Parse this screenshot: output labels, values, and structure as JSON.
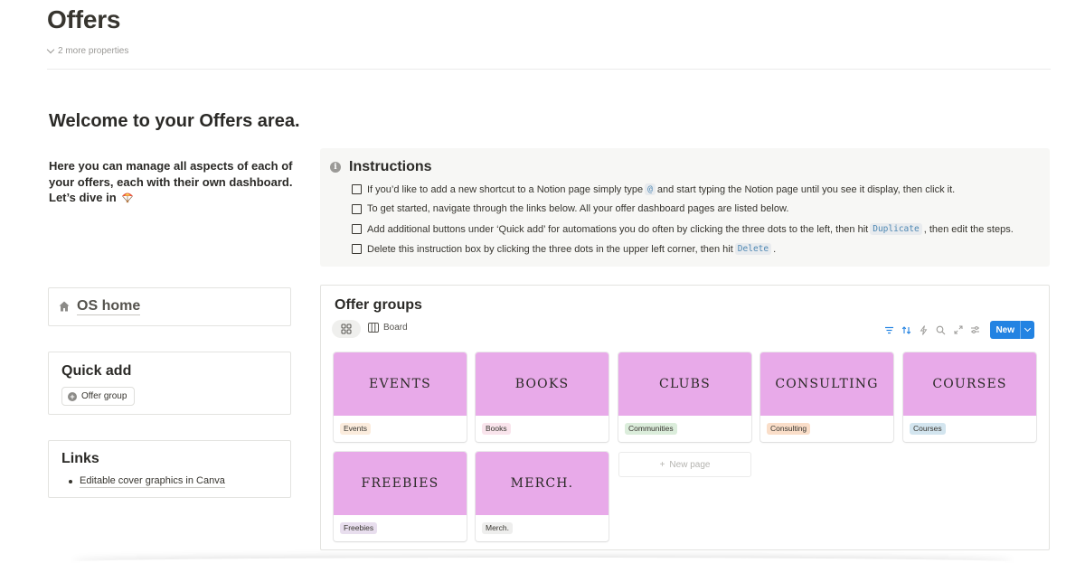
{
  "page": {
    "title": "Offers",
    "more_properties": "2 more properties"
  },
  "welcome": {
    "heading": "Welcome to your Offers area.",
    "intro": "Here you can manage all aspects of each of your offers, each with their own dashboard. Let’s dive in"
  },
  "instructions": {
    "title": "Instructions",
    "items": [
      {
        "before": "If you’d like to add a new shortcut to a Notion page simply type ",
        "code": "@",
        "after": " and start typing the Notion page until you see it display, then click it."
      },
      {
        "before": "To get started, navigate through the links below. All your offer dashboard pages are listed below.",
        "code": "",
        "after": ""
      },
      {
        "before": "Add additional buttons under ‘Quick add’ for automations you do often by clicking the three dots to the left, then hit ",
        "code": "Duplicate",
        "after": ", then edit the steps."
      },
      {
        "before": "Delete this instruction box by clicking the three dots in the upper left corner, then hit ",
        "code": "Delete",
        "after": "."
      }
    ]
  },
  "os_home": {
    "label": "OS home"
  },
  "quick_add": {
    "title": "Quick add",
    "button": "Offer group"
  },
  "links": {
    "title": "Links",
    "items": [
      "Editable cover graphics in Canva"
    ]
  },
  "offer_groups": {
    "title": "Offer groups",
    "view_label": "Board",
    "new_button": "New",
    "new_page": "New page",
    "cards": [
      {
        "cover": "EVENTS",
        "tag": "Events",
        "tag_bg": "#fbecdd"
      },
      {
        "cover": "BOOKS",
        "tag": "Books",
        "tag_bg": "#f9e4ec"
      },
      {
        "cover": "CLUBS",
        "tag": "Communities",
        "tag_bg": "#dbeddb"
      },
      {
        "cover": "CONSULTING",
        "tag": "Consulting",
        "tag_bg": "#fadec9"
      },
      {
        "cover": "COURSES",
        "tag": "Courses",
        "tag_bg": "#d3e5ef"
      },
      {
        "cover": "FREEBIES",
        "tag": "Freebies",
        "tag_bg": "#e8deee"
      },
      {
        "cover": "MERCH.",
        "tag": "Merch.",
        "tag_bg": "#eeeeed"
      }
    ]
  },
  "colors": {
    "accent": "#2383e2",
    "cover": "#e8aae9",
    "callout_bg": "#f7f7f5",
    "text": "#37352f"
  },
  "icons": [
    "chevron-down-icon",
    "info-icon",
    "parachute-icon",
    "home-icon",
    "plus-circle-icon",
    "gallery-view-icon",
    "board-view-icon",
    "filter-icon",
    "sort-icon",
    "lightning-icon",
    "search-icon",
    "expand-icon",
    "settings-sliders-icon"
  ]
}
